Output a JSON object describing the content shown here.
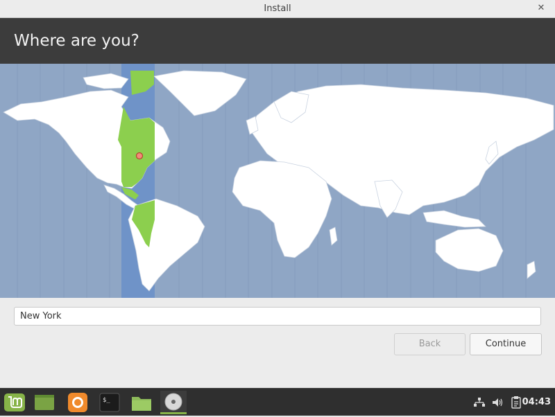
{
  "window": {
    "title": "Install",
    "close_glyph": "✕"
  },
  "header": {
    "title": "Where are you?"
  },
  "map": {
    "ocean_color": "#8fa6c5",
    "land_color": "#ffffff",
    "selected_region_color": "#8ccf4e",
    "selected_band_color": "#6f93c8"
  },
  "timezone": {
    "value": "New York"
  },
  "buttons": {
    "back": "Back",
    "continue": "Continue"
  },
  "panel": {
    "launchers": [
      {
        "name": "menu-icon",
        "label": "Linux Mint menu"
      },
      {
        "name": "show-desktop-icon",
        "label": "Show desktop"
      },
      {
        "name": "firefox-icon",
        "label": "Firefox"
      },
      {
        "name": "terminal-icon",
        "label": "Terminal"
      },
      {
        "name": "files-icon",
        "label": "Files"
      },
      {
        "name": "install-disc-icon",
        "label": "Install"
      }
    ],
    "tray": [
      "network-icon",
      "volume-icon",
      "clipboard-icon"
    ],
    "clock": "04:43"
  }
}
